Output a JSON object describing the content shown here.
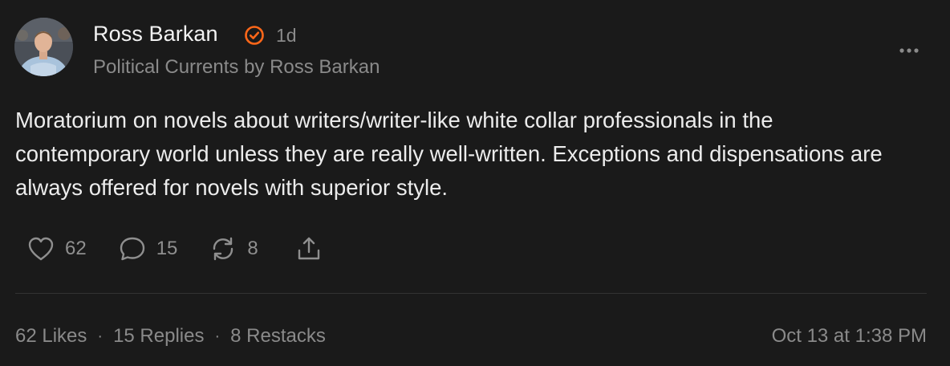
{
  "author": {
    "name": "Ross Barkan",
    "time_ago": "1d",
    "publication": "Political Currents by Ross Barkan",
    "verified_icon": "check-badge-icon"
  },
  "note": {
    "text": "Moratorium on novels about writers/writer-like white collar professionals in the contemporary world unless they are really well-written. Exceptions and dispensations are always offered for novels with superior style."
  },
  "actions": {
    "like_count": "62",
    "reply_count": "15",
    "restack_count": "8"
  },
  "footer": {
    "likes": "62 Likes",
    "replies": "15 Replies",
    "restacks": "8 Restacks",
    "separator": "·",
    "date": "Oct 13 at 1:38 PM"
  },
  "colors": {
    "background": "#1a1a1a",
    "accent": "#ff6719",
    "text_primary": "#ececec",
    "text_secondary": "#8a8a8a"
  }
}
